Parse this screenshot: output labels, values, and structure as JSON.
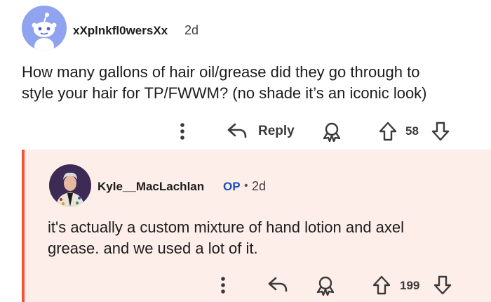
{
  "comment": {
    "username": "xXplnkfl0wersXx",
    "time": "2d",
    "body_line1": "How many gallons of hair oil/grease did they go through to",
    "body_line2": "style your hair for TP/FWWM? (no shade it’s an iconic look)",
    "actions": {
      "more_icon": "vertical-dots-icon",
      "reply_label": "Reply",
      "award_icon": "award-icon",
      "score": "58"
    }
  },
  "reply": {
    "username": "Kyle__MacLachlan",
    "op_badge": "OP",
    "separator": "•",
    "time": "2d",
    "body_line1": "it's actually a custom mixture of hand lotion and axel",
    "body_line2": "grease. and we used a lot of it.",
    "actions": {
      "score": "199"
    }
  },
  "colors": {
    "thread_line": "#f1563b",
    "reply_background": "#fdeeea",
    "op_badge": "#1a4fbe",
    "avatar_background": "#8fa3ef"
  }
}
